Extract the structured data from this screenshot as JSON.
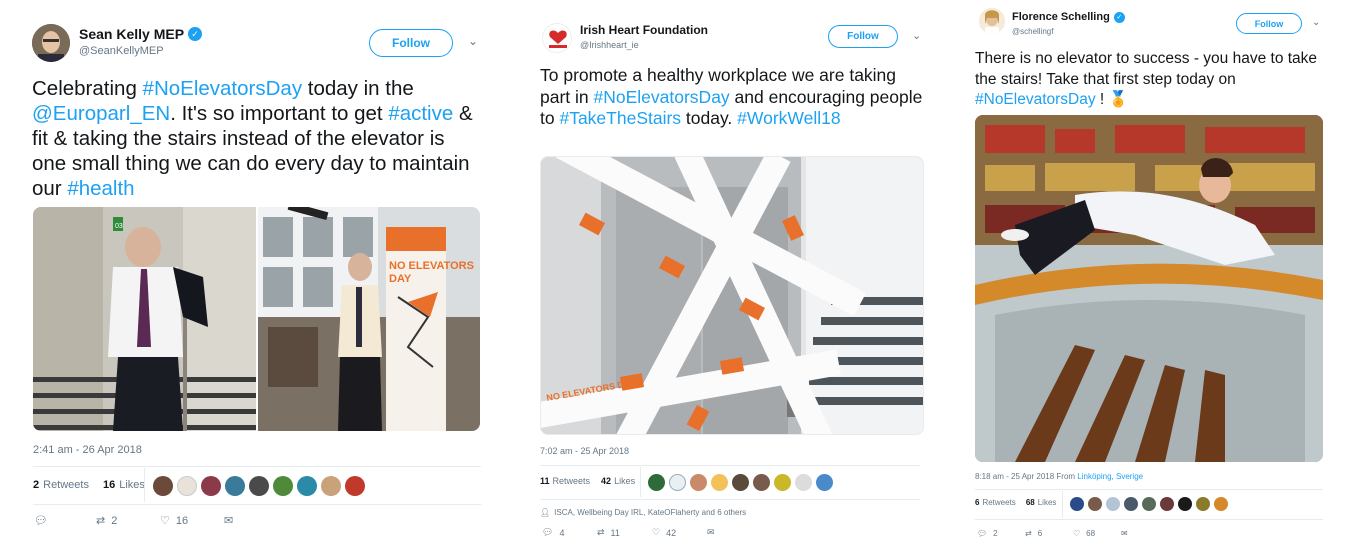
{
  "tweets": [
    {
      "name": "Sean Kelly MEP",
      "handle": "@SeanKellyMEP",
      "follow": "Follow",
      "text": [
        "Celebrating ",
        "#NoElevatorsDay",
        " today in the ",
        "@Europarl_EN",
        ". It's so important to get ",
        "#active",
        " & fit & taking the stairs instead of the elevator is one small thing we can do every day to maintain our ",
        "#health"
      ],
      "time": "2:41 am - 26 Apr 2018",
      "retweets": "2",
      "retweets_label": "Retweets",
      "likes": "16",
      "likes_label": "Likes",
      "reply": "",
      "rt": "2",
      "like": "16",
      "photo_text": {
        "sign_1": "NO ELEVATORS",
        "sign_2": "DAY",
        "tag": "03"
      }
    },
    {
      "name": "Irish Heart Foundation",
      "handle": "@Irishheart_ie",
      "follow": "Follow",
      "text": [
        "To promote a healthy workplace we are taking part in ",
        "#NoElevatorsDay",
        " and encouraging people to ",
        "#TakeTheStairs",
        " today. ",
        "#WorkWell18"
      ],
      "time": "7:02 am - 25 Apr 2018",
      "retweets": "11",
      "retweets_label": "Retweets",
      "likes": "42",
      "likes_label": "Likes",
      "also": "ISCA, Wellbeing Day IRL, KateOFlaherty and 6 others",
      "reply": "4",
      "rt": "11",
      "like": "42",
      "photo_text": {
        "tape": "NO ELEVATORS DAY"
      }
    },
    {
      "name": "Florence Schelling",
      "handle": "@schellingf",
      "follow": "Follow",
      "text": [
        "There is no elevator to success - you have to take the stairs! Take that first step today on ",
        "#NoElevatorsDay",
        " ! 🏅"
      ],
      "time": "8:18 am - 25 Apr 2018 From ",
      "place": "Linköping, Sverige",
      "retweets": "6",
      "retweets_label": "Retweets",
      "likes": "68",
      "likes_label": "Likes",
      "reply": "2",
      "rt": "6",
      "like": "68"
    }
  ],
  "colors": {
    "link": "#1da1f2",
    "muted": "#657786",
    "orange": "#e8702a"
  }
}
